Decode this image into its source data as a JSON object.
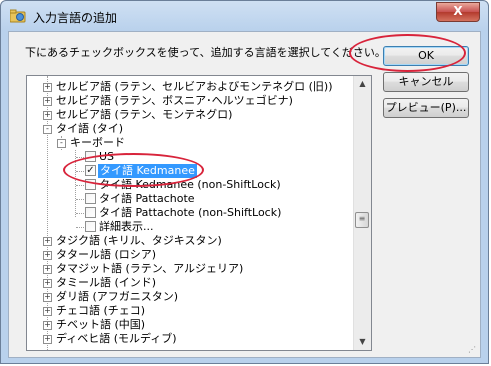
{
  "window": {
    "title": "入力言語の追加",
    "close_label": "X"
  },
  "instruction": "下にあるチェックボックスを使って、追加する言語を選択してください。",
  "buttons": {
    "ok": "OK",
    "cancel": "キャンセル",
    "preview": "プレビュー(P)..."
  },
  "tree": [
    {
      "label": "セルビア語 (ラテン、セルビアおよびモンテネグロ (旧))",
      "expander": "+"
    },
    {
      "label": "セルビア語 (ラテン、ボスニア･ヘルツェゴビナ)",
      "expander": "+"
    },
    {
      "label": "セルビア語 (ラテン、モンテネグロ)",
      "expander": "+"
    },
    {
      "label": "タイ語 (タイ)",
      "expander": "-"
    },
    {
      "label": "キーボード",
      "expander": "-"
    },
    {
      "label": "US",
      "checked": false
    },
    {
      "label": "タイ語 Kedmanee",
      "checked": true,
      "selected": true
    },
    {
      "label": "タイ語 Kedmanee (non-ShiftLock)",
      "checked": false
    },
    {
      "label": "タイ語 Pattachote",
      "checked": false
    },
    {
      "label": "タイ語 Pattachote (non-ShiftLock)",
      "checked": false
    },
    {
      "label": "詳細表示..."
    },
    {
      "label": "タジク語 (キリル、タジキスタン)",
      "expander": "+"
    },
    {
      "label": "タタール語 (ロシア)",
      "expander": "+"
    },
    {
      "label": "タマジット語 (ラテン、アルジェリア)",
      "expander": "+"
    },
    {
      "label": "タミール語 (インド)",
      "expander": "+"
    },
    {
      "label": "ダリ語 (アフガニスタン)",
      "expander": "+"
    },
    {
      "label": "チェコ語 (チェコ)",
      "expander": "+"
    },
    {
      "label": "チベット語 (中国)",
      "expander": "+"
    },
    {
      "label": "ディベヒ語 (モルディブ)",
      "expander": "+"
    }
  ]
}
